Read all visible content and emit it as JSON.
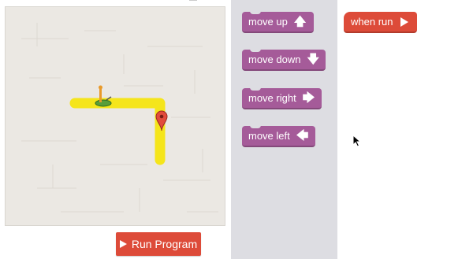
{
  "maze": {
    "path_color": "#f5e51b",
    "marker_color": "#e24b3b",
    "pegman_icon": "pegman-icon",
    "marker_icon": "map-pin-icon"
  },
  "controls": {
    "run_label": "Run Program",
    "run_icon": "play-icon",
    "run_color": "#dd4b39"
  },
  "toolbox": {
    "background": "#dddde2",
    "block_color": "#a55b99",
    "blocks": [
      {
        "label": "move up",
        "arrow": "🡅",
        "icon": "arrow-up-icon"
      },
      {
        "label": "move down",
        "arrow": "🡇",
        "icon": "arrow-down-icon"
      },
      {
        "label": "move right",
        "arrow": "🡆",
        "icon": "arrow-right-icon"
      },
      {
        "label": "move left",
        "arrow": "🡄",
        "icon": "arrow-left-icon"
      }
    ]
  },
  "workspace": {
    "when_run_label": "when run",
    "when_run_icon": "play-icon",
    "when_run_color": "#dd4b39"
  }
}
